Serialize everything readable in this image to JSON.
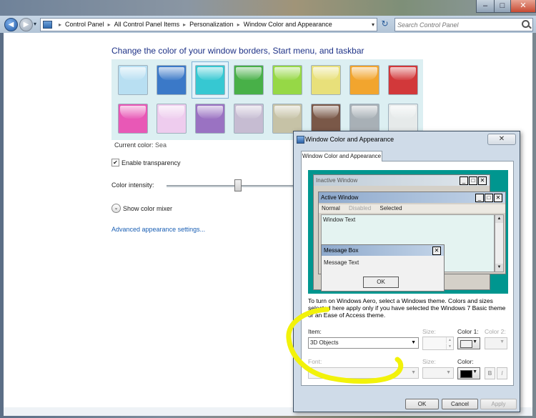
{
  "window": {
    "min_glyph": "–",
    "max_glyph": "□",
    "close_glyph": "✕"
  },
  "nav": {
    "back_glyph": "◀",
    "forward_glyph": "▶",
    "dropdown_glyph": "▾",
    "refresh_glyph": "↻"
  },
  "address": {
    "breadcrumbs": [
      "Control Panel",
      "All Control Panel Items",
      "Personalization",
      "Window Color and Appearance"
    ],
    "separator": "▸",
    "dropdown_glyph": "▾"
  },
  "search": {
    "placeholder": "Search Control Panel"
  },
  "page": {
    "heading": "Change the color of your window borders, Start menu, and taskbar",
    "swatches_row1": [
      "#b8dff2",
      "#3b79c8",
      "#36c8d2",
      "#48b048",
      "#96d846",
      "#e8e07a",
      "#f2a52e",
      "#d2383a"
    ],
    "swatches_row2": [
      "#e858b6",
      "#eeccee",
      "#9a72c2",
      "#c6bcd2",
      "#c6c2a6",
      "#7a5848",
      "#a8b0b6",
      "#e6eaea"
    ],
    "selected_index": 2,
    "current_color_label": "Current color:",
    "current_color_value": "Sea",
    "transparency_label": "Enable transparency",
    "transparency_checked": true,
    "check_glyph": "✔",
    "intensity_label": "Color intensity:",
    "intensity_level": 0.55,
    "mixer_label": "Show color mixer",
    "mixer_glyph": "⌄",
    "advanced_link": "Advanced appearance settings..."
  },
  "dialog": {
    "title": "Window Color and Appearance",
    "close_glyph": "✕",
    "tab_label": "Window Color and Appearance",
    "preview": {
      "inactive_title": "Inactive Window",
      "active_title": "Active Window",
      "menu_normal": "Normal",
      "menu_disabled": "Disabled",
      "menu_selected": "Selected",
      "window_text": "Window Text",
      "msg_title": "Message Box",
      "msg_text": "Message Text",
      "msg_ok": "OK",
      "btn_min": "_",
      "btn_max": "□",
      "btn_close": "✕",
      "scroll_up": "▲",
      "scroll_down": "▼"
    },
    "aero_note": "To turn on Windows Aero, select a Windows theme.  Colors and sizes selected here apply only if you have selected the Windows 7 Basic theme or an Ease of Access theme.",
    "item_label": "Item:",
    "item_value": "3D Objects",
    "size_label": "Size:",
    "color1_label": "Color 1:",
    "color2_label": "Color 2:",
    "font_label": "Font:",
    "font_size_label": "Size:",
    "font_color_label": "Color:",
    "bold_label": "B",
    "italic_label": "I",
    "arrow_glyph": "▼",
    "color1_value": "#f0f0f0",
    "font_color_value": "#000000",
    "ok_label": "OK",
    "cancel_label": "Cancel",
    "apply_label": "Apply",
    "highlight_color": "#f2f20a"
  }
}
